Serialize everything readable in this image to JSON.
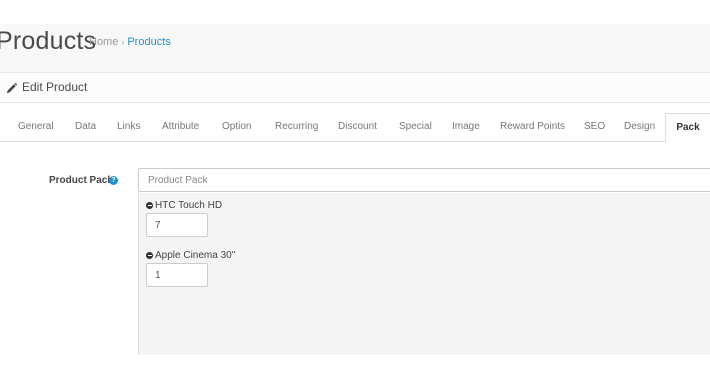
{
  "page": {
    "title": "Products",
    "breadcrumb": {
      "home": "Home",
      "separator": "›",
      "current": "Products"
    }
  },
  "panel": {
    "heading": "Edit Product",
    "icon": "pencil-icon"
  },
  "tabs": [
    {
      "label": "General"
    },
    {
      "label": "Data"
    },
    {
      "label": "Links"
    },
    {
      "label": "Attribute"
    },
    {
      "label": "Option"
    },
    {
      "label": "Recurring"
    },
    {
      "label": "Discount"
    },
    {
      "label": "Special"
    },
    {
      "label": "Image"
    },
    {
      "label": "Reward Points"
    },
    {
      "label": "SEO"
    },
    {
      "label": "Design"
    },
    {
      "label": "Pack",
      "active": true
    }
  ],
  "form": {
    "product_pack_label": "Product Pack",
    "help_icon": "?",
    "product_pack_placeholder": "Product Pack",
    "items": [
      {
        "name": "HTC Touch HD",
        "quantity": "7"
      },
      {
        "name": "Apple Cinema 30\"",
        "quantity": "1"
      }
    ]
  },
  "colors": {
    "link": "#1e91cf",
    "well": "#f5f5f5",
    "border": "#dddddd"
  }
}
